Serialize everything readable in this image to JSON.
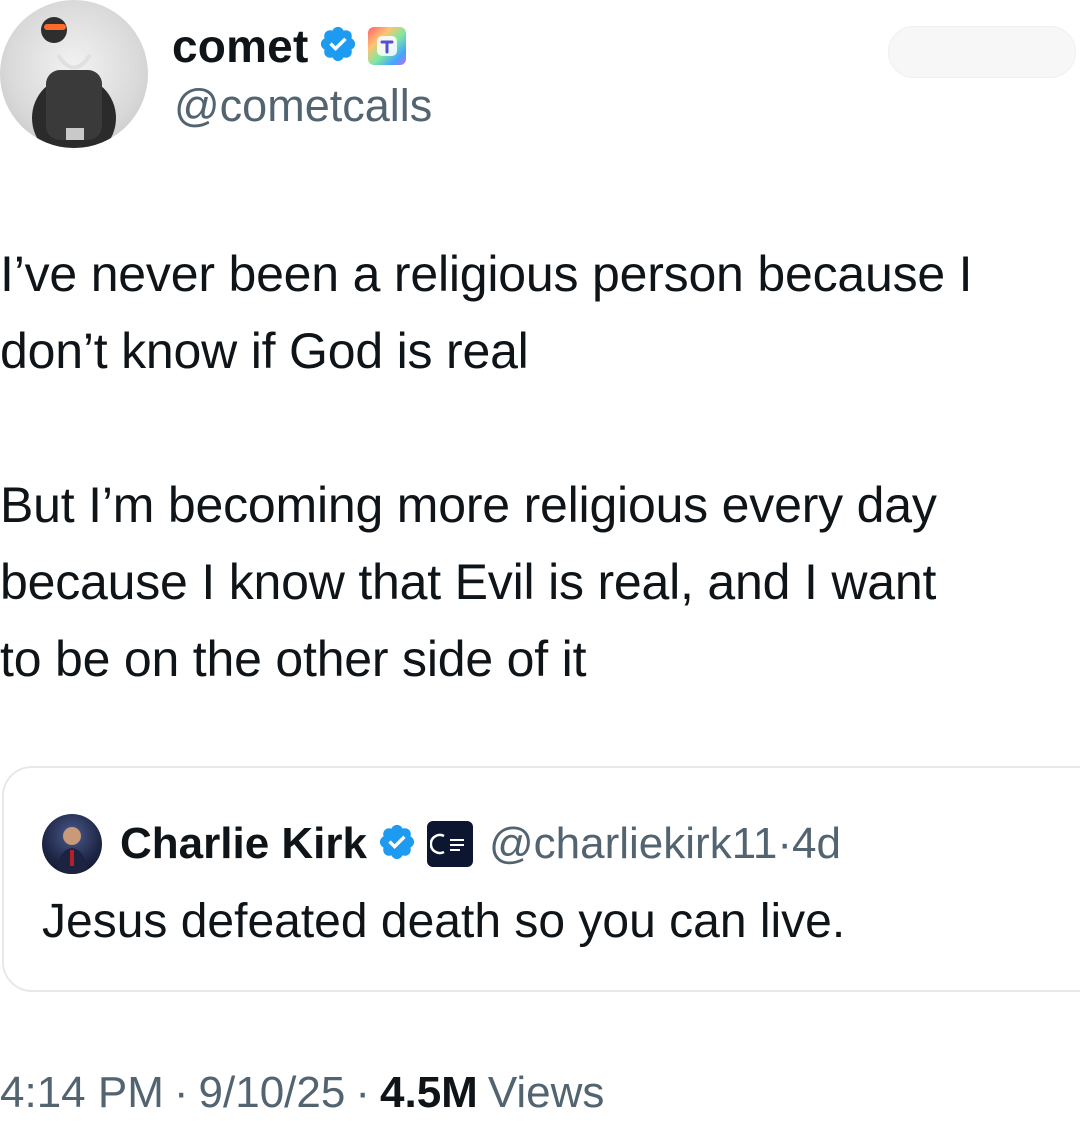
{
  "author": {
    "name": "comet",
    "handle": "@cometcalls"
  },
  "tweet": {
    "paragraph_1": "I’ve never been a religious person because I\ndon’t know if God is real",
    "paragraph_2": "But I’m becoming more religious every day\nbecause I know that Evil is real, and I want\nto be on the other side of it"
  },
  "quote": {
    "name": "Charlie Kirk",
    "handle": "@charliekirk11",
    "separator": "·",
    "age": "4d",
    "text": "Jesus defeated death so you can live."
  },
  "meta": {
    "time": "4:14 PM",
    "date": "9/10/25",
    "sep": "·",
    "views_count": "4.5M",
    "views_label": "Views"
  },
  "colors": {
    "verified": "#1d9bf0",
    "text_primary": "#0f1419",
    "text_secondary": "#536471",
    "border": "#e6e9ec"
  },
  "icons": {
    "verified": "verified-badge-icon",
    "affiliate": "affiliate-badge-icon",
    "org": "org-badge-icon"
  }
}
